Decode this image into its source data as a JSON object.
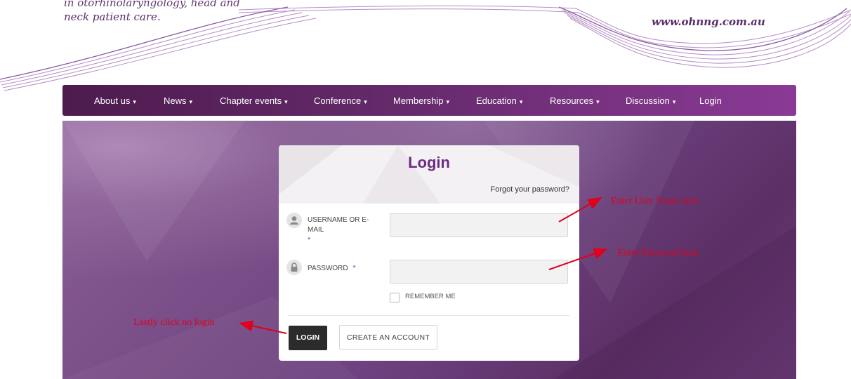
{
  "header": {
    "tagline_line1": "in otorhinolaryngology, head and",
    "tagline_line2": "neck patient care.",
    "site_url": "www.ohnng.com.au"
  },
  "nav": {
    "items": [
      {
        "label": "About us",
        "dropdown": true
      },
      {
        "label": "News",
        "dropdown": true
      },
      {
        "label": "Chapter events",
        "dropdown": true
      },
      {
        "label": "Conference",
        "dropdown": true
      },
      {
        "label": "Membership",
        "dropdown": true
      },
      {
        "label": "Education",
        "dropdown": true
      },
      {
        "label": "Resources",
        "dropdown": true
      },
      {
        "label": "Discussion",
        "dropdown": true
      },
      {
        "label": "Login",
        "dropdown": false
      }
    ],
    "caret": "▾"
  },
  "login_form": {
    "title": "Login",
    "forgot_link": "Forgot your password?",
    "username_label_1": "USERNAME OR E-",
    "username_label_2": "MAIL",
    "required_mark": "*",
    "username_value": "",
    "password_label": "PASSWORD",
    "password_value": "",
    "remember_label": "REMEMBER ME",
    "login_button": "LOGIN",
    "create_account_button": "CREATE AN ACCOUNT"
  },
  "annotations": {
    "username_hint": "Enter User Name here",
    "password_hint": "Enter Password here",
    "login_hint": "Lastly click no login"
  },
  "colors": {
    "brand_purple": "#6b2d7f",
    "nav_gradient_start": "#4d1b4e",
    "nav_gradient_end": "#8a3a95",
    "annotation_red": "#e0001b",
    "required_blue": "#3a67b5"
  },
  "icons": {
    "username": "user-icon",
    "password": "lock-icon"
  }
}
